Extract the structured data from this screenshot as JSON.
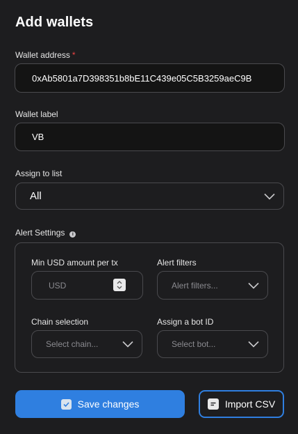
{
  "title": "Add wallets",
  "wallet_address": {
    "label": "Wallet address",
    "required_marker": "*",
    "value": "0xAb5801a7D398351b8bE11C439e05C5B3259aeC9B"
  },
  "wallet_label": {
    "label": "Wallet label",
    "value": "VB"
  },
  "assign_list": {
    "label": "Assign to list",
    "selected": "All"
  },
  "alert_settings": {
    "label": "Alert Settings",
    "min_usd": {
      "label": "Min USD amount per tx",
      "placeholder": "USD"
    },
    "alert_filters": {
      "label": "Alert filters",
      "placeholder": "Alert filters..."
    },
    "chain_selection": {
      "label": "Chain selection",
      "placeholder": "Select chain..."
    },
    "bot_id": {
      "label": "Assign a bot ID",
      "placeholder": "Select bot..."
    }
  },
  "buttons": {
    "save": "Save changes",
    "import": "Import CSV"
  },
  "colors": {
    "background": "#1d1d1f",
    "input_bg": "#141414",
    "border": "#4a4a4e",
    "accent": "#2f7fe0",
    "required": "#ef4444"
  }
}
